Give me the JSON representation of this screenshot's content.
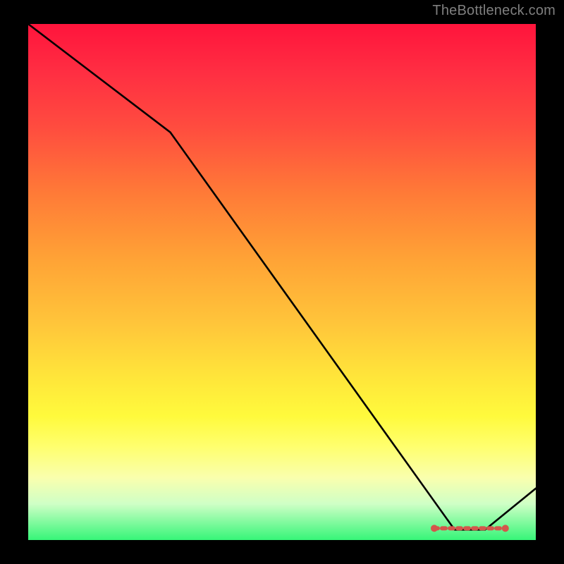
{
  "attribution": "TheBottleneck.com",
  "chart_data": {
    "type": "line",
    "title": "",
    "xlabel": "",
    "ylabel": "",
    "xlim": [
      0,
      100
    ],
    "ylim": [
      0,
      100
    ],
    "x": [
      0,
      28,
      84,
      90,
      100
    ],
    "values": [
      100,
      79,
      2,
      2,
      10
    ],
    "highlight_band": {
      "x0": 80,
      "x1": 94,
      "y": 2
    },
    "gradient_stops": [
      {
        "pos": 0,
        "color": "#FF143C"
      },
      {
        "pos": 100,
        "color": "#36F578"
      }
    ]
  }
}
